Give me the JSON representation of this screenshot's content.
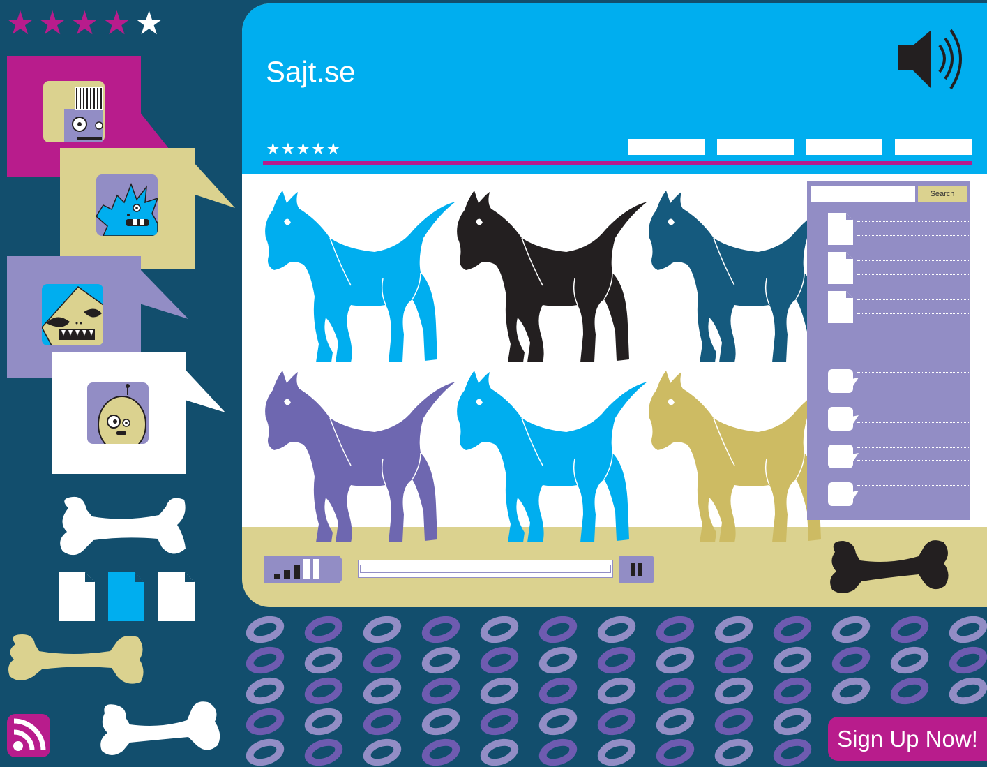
{
  "site": {
    "title": "Sajt.se"
  },
  "rating": {
    "stars_filled": 4,
    "stars_total": 5,
    "text_left": "★★★★★",
    "header_text": "★★★★★"
  },
  "nav": {
    "tabs": [
      "",
      "",
      "",
      ""
    ]
  },
  "search": {
    "placeholder": "",
    "button_label": "Search"
  },
  "media": {
    "volume_level": 0.75,
    "progress": 0.0
  },
  "cta": {
    "label": "Sign Up Now!"
  },
  "colors": {
    "brand_blue": "#00aeef",
    "magenta": "#b81c8c",
    "lavender": "#928dc5",
    "khaki": "#dbd28f",
    "navy": "#124e6d",
    "dark_teal": "#155a7e"
  },
  "dogs": [
    {
      "color": "#00aeef"
    },
    {
      "color": "#231f20"
    },
    {
      "color": "#155a7e"
    },
    {
      "color": "#6e67b0"
    },
    {
      "color": "#00aeef"
    },
    {
      "color": "#cdbb63"
    }
  ],
  "icons": [
    "speaker-icon",
    "rss-icon",
    "pause-icon",
    "signal-bars-icon",
    "bone-icon",
    "document-icon",
    "chat-bubble-icon",
    "monster-avatar-icon"
  ]
}
